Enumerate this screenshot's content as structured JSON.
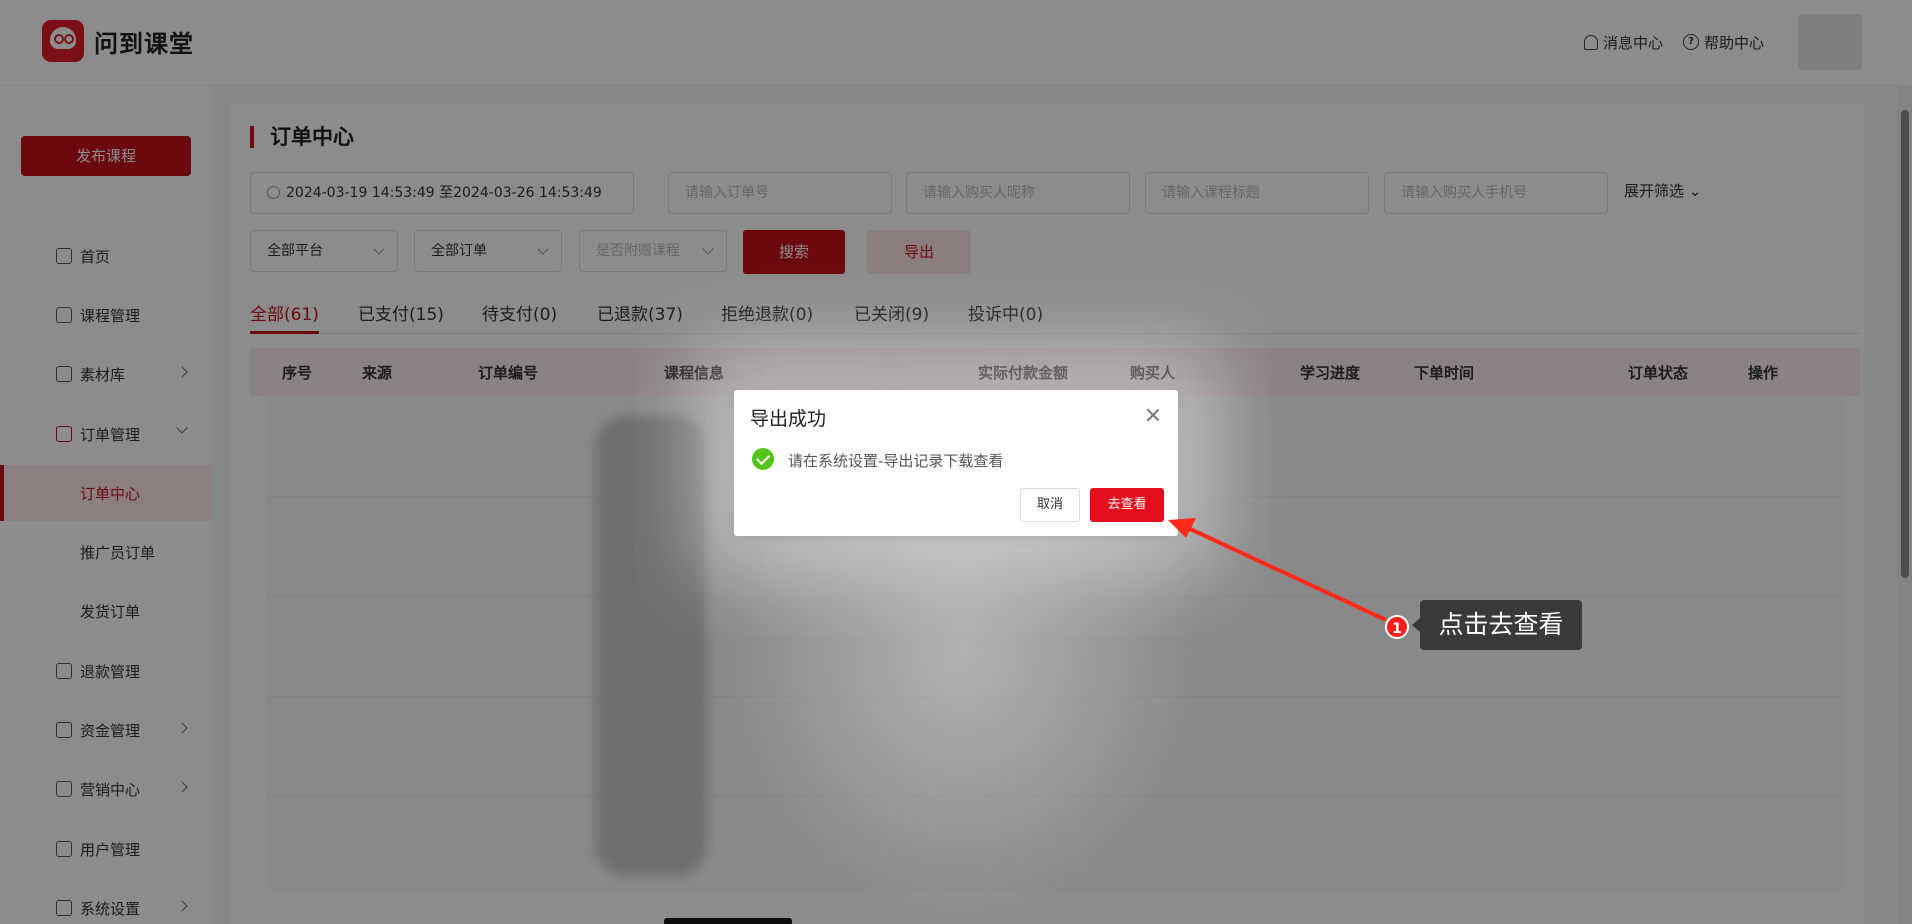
{
  "brand": {
    "name": "问到课堂"
  },
  "header": {
    "messages": "消息中心",
    "help": "帮助中心"
  },
  "sidebar": {
    "publish": "发布课程",
    "items": [
      {
        "label": "首页",
        "icon": "home-icon"
      },
      {
        "label": "课程管理",
        "icon": "course-icon"
      },
      {
        "label": "素材库",
        "icon": "folder-icon"
      },
      {
        "label": "订单管理",
        "icon": "order-icon"
      },
      {
        "label": "订单中心"
      },
      {
        "label": "推广员订单"
      },
      {
        "label": "发货订单"
      },
      {
        "label": "退款管理",
        "icon": "refund-icon"
      },
      {
        "label": "资金管理",
        "icon": "wallet-icon"
      },
      {
        "label": "营销中心",
        "icon": "gift-icon"
      },
      {
        "label": "用户管理",
        "icon": "user-icon"
      },
      {
        "label": "系统设置",
        "icon": "gear-icon"
      }
    ]
  },
  "page": {
    "title": "订单中心"
  },
  "filters": {
    "date_range": "2024-03-19 14:53:49 至2024-03-26 14:53:49",
    "order_no_placeholder": "请输入订单号",
    "buyer_nick_placeholder": "请输入购买人昵称",
    "course_title_placeholder": "请输入课程标题",
    "buyer_phone_placeholder": "请输入购买人手机号",
    "expand": "展开筛选",
    "platform": "全部平台",
    "order_type": "全部订单",
    "attached": "是否附赠课程",
    "search": "搜索",
    "export": "导出"
  },
  "tabs": [
    "全部(61)",
    "已支付(15)",
    "待支付(0)",
    "已退款(37)",
    "拒绝退款(0)",
    "已关闭(9)",
    "投诉中(0)"
  ],
  "table": {
    "headers": [
      "序号",
      "来源",
      "订单编号",
      "课程信息",
      "实际付款金额",
      "购买人",
      "学习进度",
      "下单时间",
      "订单状态",
      "操作"
    ]
  },
  "dialog": {
    "title": "导出成功",
    "message": "请在系统设置-导出记录下载查看",
    "cancel": "取消",
    "confirm": "去查看"
  },
  "annotation": {
    "step": "1",
    "text": "点击去查看"
  },
  "colors": {
    "brand_red": "#c5111c",
    "confirm_red": "#e50d1e",
    "success_green": "#52c41a"
  }
}
